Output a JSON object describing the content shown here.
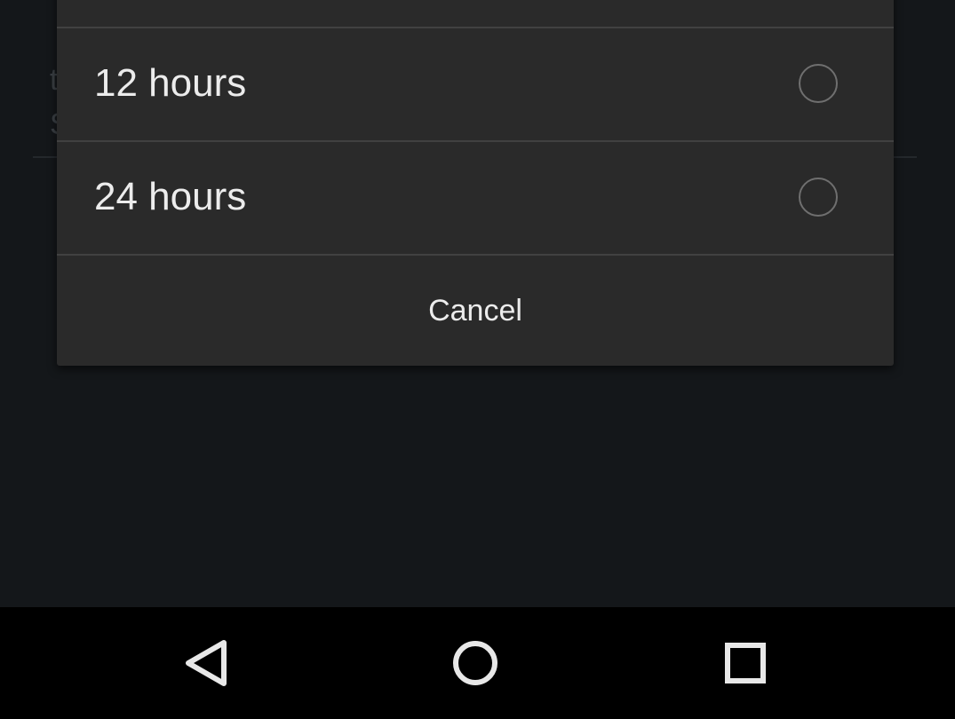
{
  "dialog": {
    "options": [
      {
        "label": "12 hours",
        "selected": false
      },
      {
        "label": "24 hours",
        "selected": false
      }
    ],
    "cancel_label": "Cancel"
  },
  "navbar": {
    "back_icon": "back-triangle-icon",
    "home_icon": "home-circle-icon",
    "recents_icon": "recents-square-icon"
  },
  "colors": {
    "dialog_bg": "#2a2a2a",
    "divider": "#414141",
    "text": "#ececec",
    "radio_ring": "#6f6f6f",
    "app_bg": "#14171a",
    "navbar_bg": "#000000"
  }
}
